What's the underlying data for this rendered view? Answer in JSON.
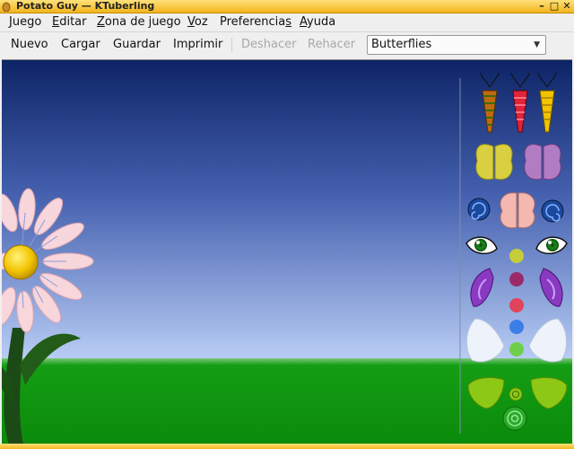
{
  "window": {
    "title": "Potato Guy — KTuberling",
    "controls": [
      "minimize",
      "maximize",
      "close"
    ]
  },
  "menu": {
    "items": [
      "Juego",
      "Editar",
      "Zona de juego",
      "Voz",
      "Preferencias",
      "Ayuda"
    ],
    "mnemonics": [
      "J",
      "E",
      "Z",
      "V",
      "s",
      "A"
    ]
  },
  "toolbar": {
    "new": "Nuevo",
    "load": "Cargar",
    "save": "Guardar",
    "print": "Imprimir",
    "undo": "Deshacer",
    "redo": "Rehacer",
    "undo_enabled": false,
    "redo_enabled": false
  },
  "playground": {
    "selected": "Butterflies"
  },
  "palette": {
    "categories": [
      "antennae",
      "wings",
      "spirals",
      "eyes",
      "dots",
      "leaves"
    ]
  },
  "colors": {
    "titlebar": "#f4bf2c",
    "sky_top": "#0d2466",
    "sky_bottom": "#b9cdf5",
    "grass": "#0f9a0f",
    "petal": "#f7d6dc",
    "flower_center": "#f2c400"
  }
}
